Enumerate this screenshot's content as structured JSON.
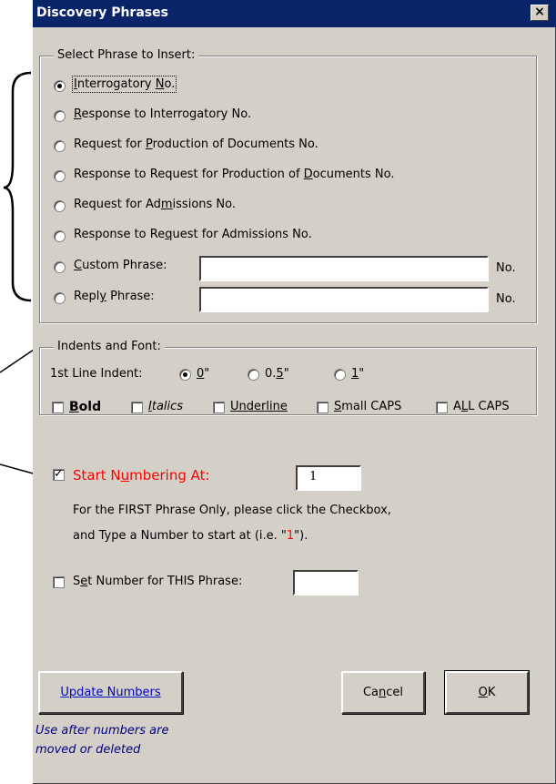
{
  "window": {
    "title": "Discovery Phrases",
    "close_label": "×"
  },
  "phrases": {
    "group_label": "Select Phrase to Insert:",
    "options": [
      {
        "pre": "",
        "ul": "I",
        "post": "nterrogatory ",
        "ul2": "N",
        "post2": "o.",
        "checked": true
      },
      {
        "pre": "",
        "ul": "R",
        "post": "esponse to Interrogatory No.",
        "checked": false
      },
      {
        "pre": "Request for ",
        "ul": "P",
        "post": "roduction of Documents No.",
        "checked": false
      },
      {
        "pre": "Response to Request for Production of ",
        "ul": "D",
        "post": "ocuments No.",
        "checked": false
      },
      {
        "pre": "Request for Ad",
        "ul": "m",
        "post": "issions No.",
        "checked": false
      },
      {
        "pre": "Response to Re",
        "ul": "q",
        "post": "uest for Admissions No.",
        "checked": false
      },
      {
        "pre": "",
        "ul": "C",
        "post": "ustom Phrase:",
        "checked": false
      },
      {
        "pre": "Repl",
        "ul": "y",
        "post": " Phrase:",
        "checked": false
      }
    ],
    "custom_value": "",
    "reply_value": "",
    "suffix": "No."
  },
  "indents": {
    "group_label": "Indents and Font:",
    "first_line_label": "1st Line Indent:",
    "indent_options": [
      {
        "pre": "",
        "ul": "0",
        "post": "\"",
        "checked": true
      },
      {
        "pre": "0.",
        "ul": "5",
        "post": "\"",
        "checked": false
      },
      {
        "pre": "",
        "ul": "1",
        "post": "\"",
        "checked": false
      }
    ],
    "font_options": [
      {
        "pre": "",
        "ul": "B",
        "post": "old",
        "style": "bold",
        "checked": false
      },
      {
        "pre": "",
        "ul": "I",
        "post": "talics",
        "style": "italic",
        "checked": false
      },
      {
        "pre": "",
        "ul": "U",
        "post": "nderline",
        "style": "underline",
        "checked": false
      },
      {
        "pre": "",
        "ul": "S",
        "post": "mall CAPS",
        "style": "normal",
        "checked": false
      },
      {
        "pre": "A",
        "ul": "L",
        "post": "L CAPS",
        "style": "normal",
        "checked": false
      }
    ]
  },
  "numbering": {
    "start_pre": "Start N",
    "start_ul": "u",
    "start_post": "mbering At:",
    "start_checked": true,
    "start_value": "1",
    "help_line1": "For the FIRST Phrase Only, please click the Checkbox,",
    "help_line2_pre": "and Type a Number to start at (i.e. \"",
    "help_line2_num": "1",
    "help_line2_post": "\").",
    "set_pre": "S",
    "set_ul": "e",
    "set_post": "t Number for THIS Phrase:",
    "set_checked": false,
    "set_value": ""
  },
  "buttons": {
    "update_ul": "U",
    "update_rest": "pdate Numbers",
    "cancel_pre": "Ca",
    "cancel_ul": "n",
    "cancel_post": "cel",
    "ok_ul": "O",
    "ok_post": "K"
  },
  "note": {
    "line1": "Use after numbers are",
    "line2": "moved or deleted"
  },
  "colors": {
    "titlebar": "#0a246a",
    "dialog_bg": "#d4d0c8",
    "highlight_red": "#ff0000",
    "link_blue": "#0000cc",
    "note_navy": "#000080"
  }
}
